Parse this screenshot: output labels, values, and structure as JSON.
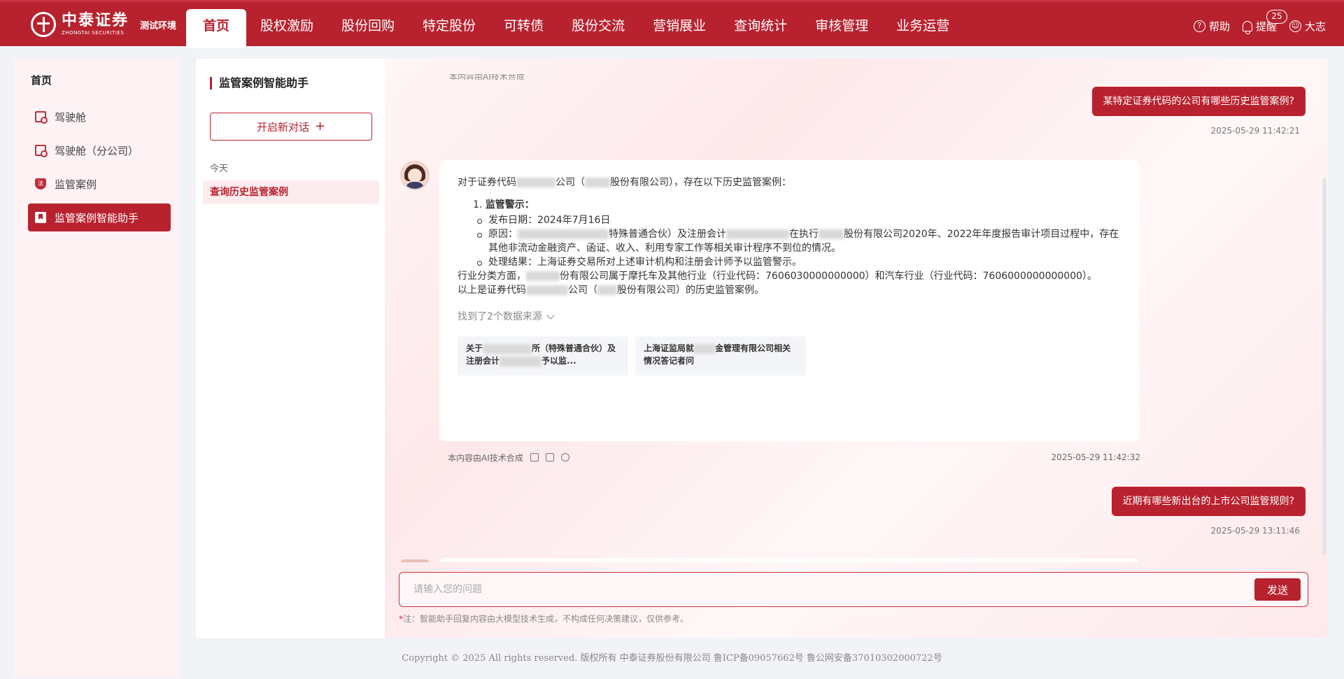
{
  "header": {
    "logo_cn": "中泰证券",
    "logo_en": "ZHONGTAI SECURITIES",
    "env_tag": "测试环境",
    "nav": [
      "首页",
      "股权激励",
      "股份回购",
      "特定股份",
      "可转债",
      "股份交流",
      "营销展业",
      "查询统计",
      "审核管理",
      "业务运营"
    ],
    "help": "帮助",
    "remind": "提醒",
    "remind_count": "25",
    "user": "大志"
  },
  "sidebar": {
    "title": "首页",
    "items": [
      {
        "label": "驾驶舱",
        "icon": "dashboard-icon"
      },
      {
        "label": "驾驶舱（分公司）",
        "icon": "dashboard-icon"
      },
      {
        "label": "监管案例",
        "icon": "law-shield-icon"
      },
      {
        "label": "监管案例智能助手",
        "icon": "bookmark-icon"
      }
    ]
  },
  "conversations": {
    "title": "监管案例智能助手",
    "new_chat": "开启新对话",
    "group_today": "今天",
    "items": [
      "查询历史监管案例"
    ]
  },
  "chat": {
    "cut_top": "本内容由AI技术合成",
    "q1": "某特定证券代码的公司有哪些历史监管案例?",
    "q1_time": "2025-05-29 11:42:21",
    "a1": {
      "intro_a": "对于证券代码",
      "intro_b": "公司（",
      "intro_c": "股份有限公司），存在以下历史监管案例：",
      "li_title": "监管警示：",
      "li_number": "1.",
      "date": "发布日期：2024年7月16日",
      "reason_a": "原因：",
      "reason_b": "特殊普通合伙）及注册会计",
      "reason_c": "在执行",
      "reason_d": "股份有限公司2020年、2022年年度报告审计项目过程中，存在其他非流动金融资产、函证、收入、利用专家工作等相关审计程序不到位的情况。",
      "result": "处理结果：上海证券交易所对上述审计机构和注册会计师予以监管警示。",
      "industry_a": "行业分类方面，",
      "industry_b": "份有限公司属于摩托车及其他行业（行业代码：7606030000000000）和汽车行业（行业代码：7606000000000000）。",
      "closing_a": "以上是证券代码",
      "closing_b": "公司（",
      "closing_c": "股份有限公司）的历史监管案例。",
      "sources": "找到了2个数据来源",
      "src1_a": "关于",
      "src1_b": "所（特殊普通合伙）及注册会计",
      "src1_c": "予以监...",
      "src2_a": "上海证监局就",
      "src2_b": "金管理有限公司相关情况答记者问"
    },
    "ai_note": "本内容由AI技术合成",
    "a1_time": "2025-05-29 11:42:32",
    "q2": "近期有哪些新出台的上市公司监管规则?",
    "q2_time": "2025-05-29 13:11:46",
    "input_placeholder": "请输入您的问题",
    "send": "发送",
    "note_star": "*",
    "note": "注：智能助手回复内容由大模型技术生成，不构成任何决策建议，仅供参考。"
  },
  "footer": "Copyright © 2025 All rights reserved. 版权所有 中泰证券股份有限公司 鲁ICP备09057662号 鲁公网安备37010302000722号",
  "colors": {
    "brand": "#b8222f",
    "accent_light": "#fdecee"
  }
}
